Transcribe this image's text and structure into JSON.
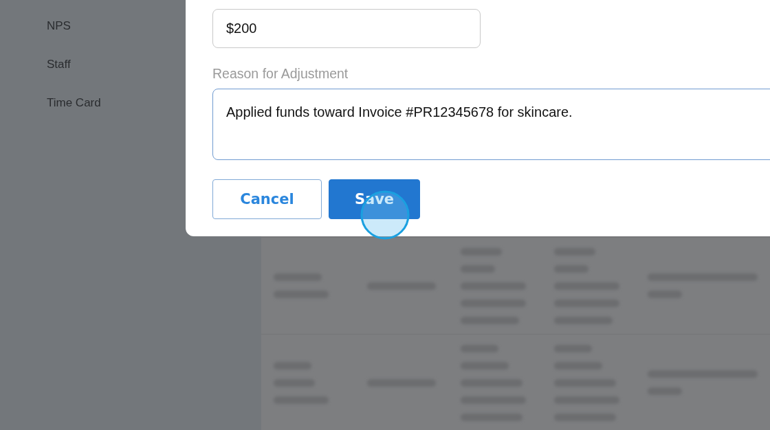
{
  "sidebar": {
    "items": [
      {
        "label": "NPS"
      },
      {
        "label": "Staff"
      },
      {
        "label": "Time Card"
      }
    ]
  },
  "dialog": {
    "amount": {
      "value": "$200"
    },
    "reason": {
      "label": "Reason for Adjustment",
      "value": "Applied funds toward Invoice #PR12345678 for skincare."
    },
    "buttons": [
      {
        "label": "Cancel",
        "kind": "secondary"
      },
      {
        "label": "Save",
        "kind": "primary"
      }
    ]
  }
}
